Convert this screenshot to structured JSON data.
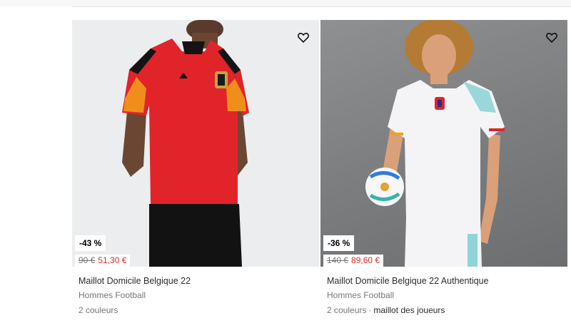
{
  "products": [
    {
      "discount": "-43 %",
      "old_price": "90 €",
      "new_price": "51,30 €",
      "name": "Maillot Domicile Belgique 22",
      "category": "Hommes Football",
      "colors": "2 couleurs",
      "extra": ""
    },
    {
      "discount": "-36 %",
      "old_price": "140 €",
      "new_price": "89,60 €",
      "name": "Maillot Domicile Belgique 22 Authentique",
      "category": "Hommes Football",
      "colors": "2 couleurs",
      "separator": "·",
      "extra": "maillot des joueurs"
    }
  ],
  "icons": {
    "wishlist": "heart-outline-icon"
  },
  "colors": {
    "sale_red": "#e32b2b",
    "jersey_red": "#e0242a",
    "muted_text": "#767677"
  }
}
